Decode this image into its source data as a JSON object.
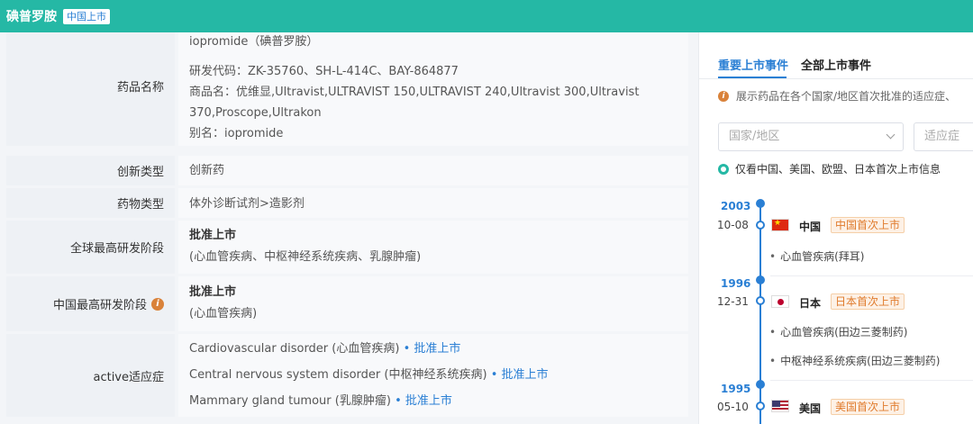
{
  "header": {
    "title": "碘普罗胺",
    "badge": "中国上市"
  },
  "drug": {
    "name_label": "药品名称",
    "name_lines": [
      "iopromide（碘普罗胺）",
      "研发代码：ZK-35760、SH-L-414C、BAY-864877",
      "商品名：优维显,Ultravist,ULTRAVIST 150,ULTRAVIST 240,Ultravist 300,Ultravist",
      "370,Proscope,Ultrakon",
      "别名：iopromide"
    ],
    "innovation_label": "创新类型",
    "innovation_value": "创新药",
    "drug_type_label": "药物类型",
    "drug_type_value": "体外诊断试剂>造影剂",
    "global_stage_label": "全球最高研发阶段",
    "global_stage_value": "批准上市",
    "global_stage_note": "(心血管疾病、中枢神经系统疾病、乳腺肿瘤)",
    "china_stage_label": "中国最高研发阶段",
    "china_stage_value": "批准上市",
    "china_stage_note": "(心血管疾病)",
    "indication_label": "active适应症",
    "indications": [
      {
        "text": "Cardiovascular disorder (心血管疾病)",
        "status": "• 批准上市"
      },
      {
        "text": "Central nervous system disorder (中枢神经系统疾病)",
        "status": "• 批准上市"
      },
      {
        "text": "Mammary gland tumour (乳腺肿瘤)",
        "status": "• 批准上市"
      }
    ]
  },
  "sidebar": {
    "tabs": [
      "重要上市事件",
      "全部上市事件"
    ],
    "note": "展示药品在各个国家/地区首次批准的适应症、",
    "country_placeholder": "国家/地区",
    "indication_placeholder": "适应症",
    "radio_label": "仅看中国、美国、欧盟、日本首次上市信息",
    "events": [
      {
        "year": "2003",
        "date": "10-08",
        "country": "中国",
        "tag": "中国首次上市",
        "indications": [
          "心血管疾病(拜耳)"
        ]
      },
      {
        "year": "1996",
        "date": "12-31",
        "country": "日本",
        "tag": "日本首次上市",
        "indications": [
          "心血管疾病(田边三菱制药)",
          "中枢神经系统疾病(田边三菱制药)"
        ]
      },
      {
        "year": "1995",
        "date": "05-10",
        "country": "美国",
        "tag": "美国首次上市",
        "indications": []
      }
    ]
  },
  "colors": {
    "header_bg": "#25b8a5",
    "accent_blue": "#2a7fd4",
    "tag_orange": "#e07b2c"
  }
}
